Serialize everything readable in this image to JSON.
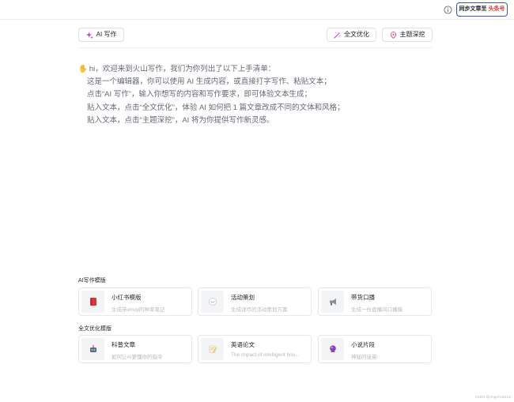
{
  "header": {
    "info_icon": "info-circle-icon",
    "sync_label_prefix": "同步文章至",
    "sync_label_target": "头条号",
    "sync_border_color": "#3d55c9",
    "sync_target_color": "#e5342f"
  },
  "toolbar": {
    "ai_write_label": "AI 写作",
    "ai_write_icon": "sparkle-icon",
    "optimize_label": "全文优化",
    "optimize_icon": "magic-wand-icon",
    "topic_label": "主题深挖",
    "topic_icon": "location-pin-icon"
  },
  "editor": {
    "lines": [
      "hi，欢迎来到火山写作，我们为你列出了以下上手清单：",
      "这是一个编辑器，你可以使用 AI 生成内容，或直接打字写作、粘贴文本；",
      "点击“AI 写作”，输入你想写的内容和写作要求，即可体验文本生成；",
      "贴入文本，点击“全文优化”，体验 AI 如何把 1 篇文章改成不同的文体和风格；",
      "贴入文本，点击“主题深挖”，AI 将为你提供写作新灵感。"
    ],
    "greeting_icon": "waving-hand-icon"
  },
  "ai_templates": {
    "title": "AI写作模版",
    "cards": [
      {
        "title": "小红书模版",
        "desc": "生成带emoji的种草笔记",
        "icon": "red-book-icon"
      },
      {
        "title": "活动策划",
        "desc": "生成详尽的活动策划方案",
        "icon": "clipboard-icon"
      },
      {
        "title": "带货口播",
        "desc": "生成一份直播间口播稿",
        "icon": "megaphone-icon"
      }
    ]
  },
  "optimize_templates": {
    "title": "全文优化模版",
    "cards": [
      {
        "title": "科普文章",
        "desc": "如何让AI更懂你的指令",
        "icon": "robot-icon"
      },
      {
        "title": "英语论文",
        "desc": "The impact of intelligent hou...",
        "icon": "memo-pencil-icon"
      },
      {
        "title": "小说片段",
        "desc": "神秘的徒弟",
        "icon": "crystal-ball-icon"
      }
    ]
  },
  "watermark": "CSDN @AngelYu0101"
}
